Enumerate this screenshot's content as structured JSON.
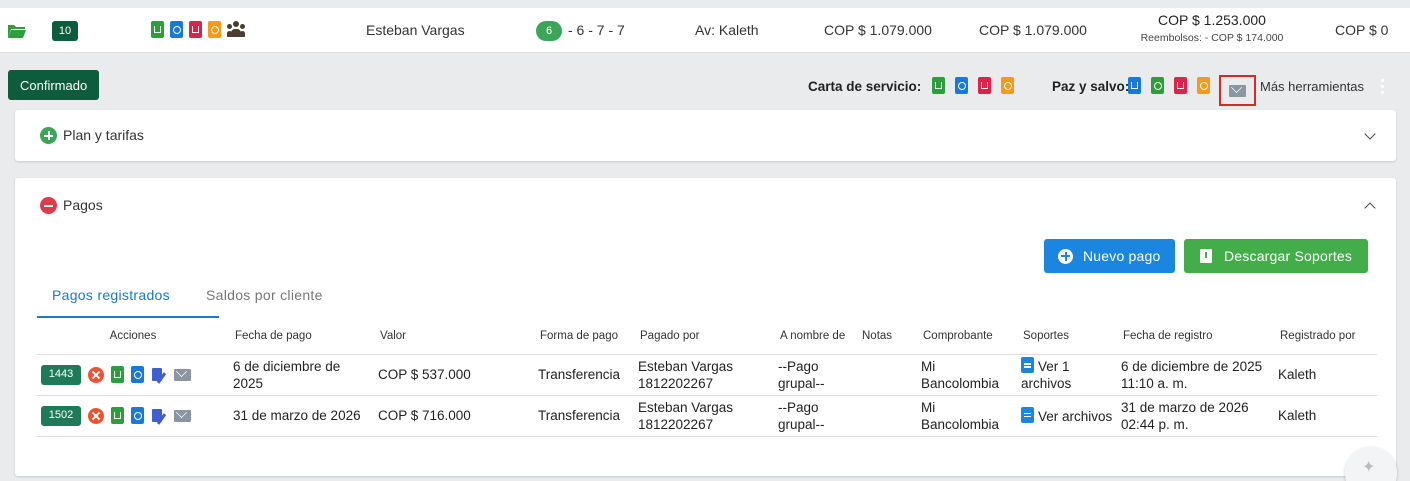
{
  "summary": {
    "count_badge": "10",
    "client_name": "Esteban Vargas",
    "circle_number": "6",
    "sequence": "- 6 - 7 - 7",
    "advisor": "Av: Kaleth",
    "amount_1": "COP $ 1.079.000",
    "amount_2": "COP $ 1.079.000",
    "total": "COP $ 1.253.000",
    "refunds": "Reembolsos: - COP $ 174.000",
    "balance": "COP $ 0"
  },
  "toolbar": {
    "status_label": "Confirmado",
    "carta_label": "Carta de servicio:",
    "paz_label": "Paz y salvo:",
    "more_tools": "Más herramientas"
  },
  "plan_card": {
    "title": "Plan y tarifas"
  },
  "payments_card": {
    "title": "Pagos",
    "new_payment": "Nuevo pago",
    "download_supports": "Descargar Soportes",
    "tabs": [
      "Pagos registrados",
      "Saldos por cliente"
    ],
    "columns": [
      "Acciones",
      "Fecha de pago",
      "Valor",
      "Forma de pago",
      "Pagado por",
      "A nombre de",
      "Notas",
      "Comprobante",
      "Soportes",
      "Fecha de registro",
      "Registrado por"
    ],
    "rows": [
      {
        "id": "1443",
        "fecha_pago": "6 de diciembre de 2025",
        "valor": "COP $ 537.000",
        "forma_pago": "Transferencia",
        "pagado_por": "Esteban Vargas 1812202267",
        "a_nombre": "--Pago grupal--",
        "notas": "",
        "comprobante": "Mi Bancolombia",
        "soportes": "Ver 1 archivos",
        "fecha_registro": "6 de diciembre de 2025 11:10 a. m.",
        "registrado_por": "Kaleth"
      },
      {
        "id": "1502",
        "fecha_pago": "31 de marzo de 2026",
        "valor": "COP $ 716.000",
        "forma_pago": "Transferencia",
        "pagado_por": "Esteban Vargas 1812202267",
        "a_nombre": "--Pago grupal--",
        "notas": "",
        "comprobante": "Mi Bancolombia",
        "soportes": "Ver archivos",
        "fecha_registro": "31 de marzo de 2026 02:44 p. m.",
        "registrado_por": "Kaleth"
      }
    ]
  },
  "icons": {
    "folder": "folder-open-icon",
    "download": "file-download-icon",
    "pdf": "file-pdf-icon",
    "mail": "mail-icon",
    "people": "people-icon",
    "cancel": "cancel-icon",
    "edit": "edit-document-icon",
    "document": "document-icon",
    "sparkle": "sparkle-icon"
  },
  "colors": {
    "brand_dark_green": "#0d5c3d",
    "green": "#2e9e3d",
    "blue": "#1a78d6",
    "red": "#e0224b",
    "orange": "#f59a1a",
    "highlight_border": "#d52a2a"
  }
}
